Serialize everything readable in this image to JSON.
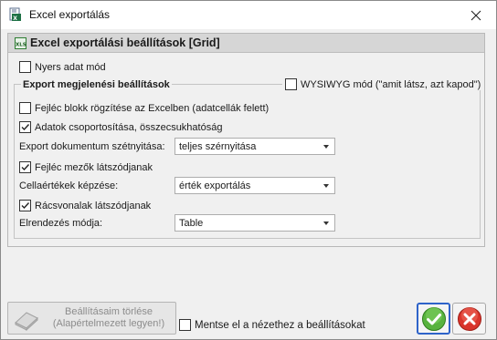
{
  "window": {
    "title": "Excel exportálás",
    "app_icon": "excel-doc-icon",
    "close_icon": "close-icon"
  },
  "panel": {
    "title": "Excel exportálási beállítások [Grid]",
    "icon": "xls-icon",
    "raw_data_mode": {
      "label": "Nyers adat mód",
      "checked": false
    },
    "group": {
      "title": "Export megjelenési beállítások",
      "wysiwyg": {
        "label": "WYSIWYG mód (\"amit látsz, azt kapod\")",
        "checked": false
      },
      "freeze_header": {
        "label": "Fejléc blokk rögzítése az Excelben (adatcellák felett)",
        "checked": false
      },
      "grouping": {
        "label": "Adatok csoportosítása, összecsukhatóság",
        "checked": true
      },
      "doc_stretch": {
        "label": "Export dokumentum szétnyitása:",
        "value": "teljes szérnyitása"
      },
      "header_fields": {
        "label": "Fejléc mezők látszódjanak",
        "checked": true
      },
      "cell_value": {
        "label": "Cellaértékek képzése:",
        "value": "érték exportálás"
      },
      "gridlines": {
        "label": "Rácsvonalak látszódjanak",
        "checked": true
      },
      "layout_mode": {
        "label": "Elrendezés módja:",
        "value": "Table"
      }
    }
  },
  "footer": {
    "reset_line1": "Beállításaim törlése",
    "reset_line2": "(Alapértelmezett legyen!)",
    "save_for_view": {
      "label": "Mentse el a nézethez a beállításokat",
      "checked": false
    },
    "ok_icon": "checkmark-icon",
    "cancel_icon": "cancel-x-icon"
  }
}
